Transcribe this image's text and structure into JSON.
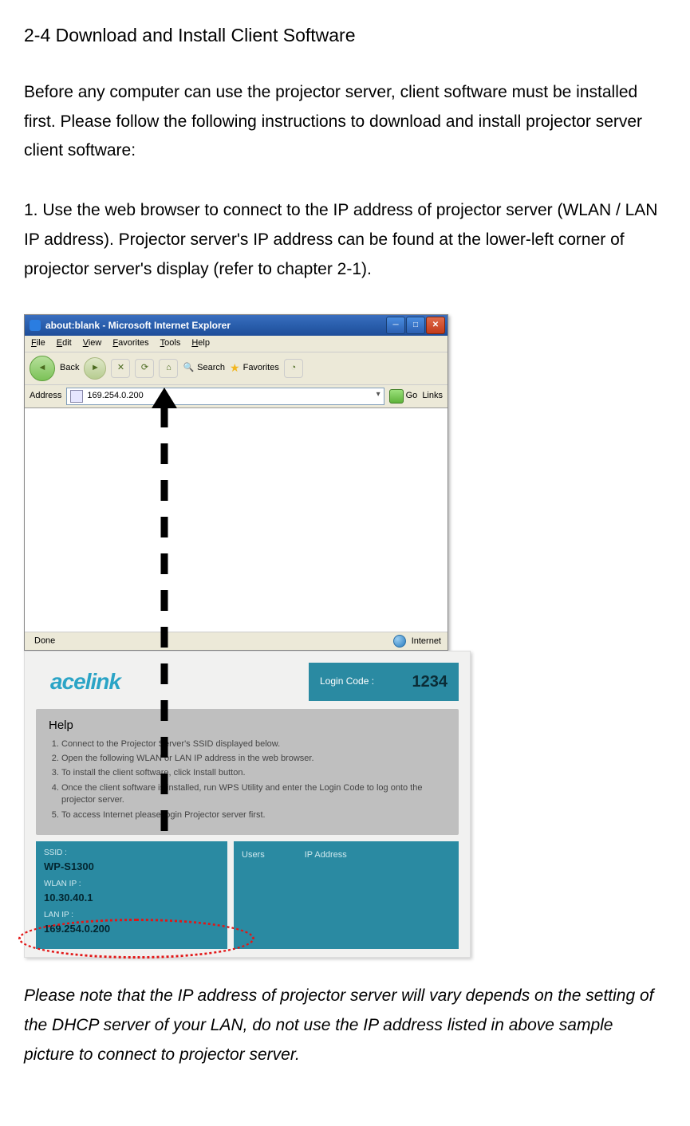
{
  "heading": "2-4 Download and Install Client Software",
  "intro": "Before any computer can use the projector server, client software must be installed first. Please follow the following instructions to download and install projector server client software:",
  "step1": "1. Use the web browser to connect to the IP address of projector server (WLAN / LAN IP address). Projector server's IP address can be found at the lower-left corner of projector server's display (refer to chapter 2-1).",
  "ie": {
    "title": "about:blank - Microsoft Internet Explorer",
    "menus": [
      "File",
      "Edit",
      "View",
      "Favorites",
      "Tools",
      "Help"
    ],
    "toolbar": {
      "back": "Back",
      "search": "Search",
      "favorites": "Favorites"
    },
    "address_label": "Address",
    "address_value": "169.254.0.200",
    "go": "Go",
    "links": "Links",
    "status_left": "Done",
    "status_right": "Internet"
  },
  "ace": {
    "logo": "acelink",
    "login_label": "Login Code :",
    "login_code": "1234",
    "help_title": "Help",
    "help_items": [
      "Connect to the Projector Server's SSID displayed below.",
      "Open the following WLAN or LAN IP address in the web browser.",
      "To install the client software, click Install button.",
      "Once the client software is installed, run WPS Utility and enter the Login Code to log onto the projector server.",
      "To access Internet please login Projector server first."
    ],
    "ssid_label": "SSID :",
    "ssid_value": "WP-S1300",
    "wlan_label": "WLAN IP :",
    "wlan_value": "10.30.40.1",
    "lan_label": "LAN IP :",
    "lan_value": "169.254.0.200",
    "users_col": "Users",
    "ip_col": "IP Address"
  },
  "note": "Please note that the IP address of projector server will vary depends on the setting of the DHCP server of your LAN, do not use the IP address listed in above sample picture to connect to projector server."
}
